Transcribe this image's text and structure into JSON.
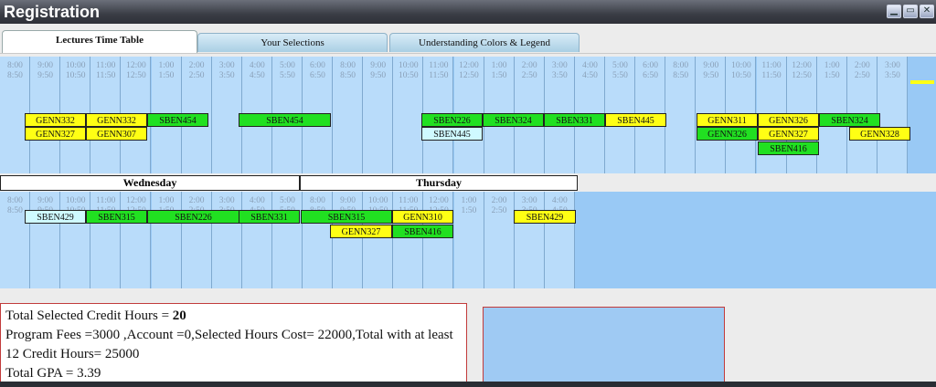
{
  "window": {
    "title": "Registration",
    "minimize": "▁",
    "maximize": "▭",
    "close": "✕"
  },
  "tabs": [
    "Lectures Time Table",
    "Your Selections",
    "Understanding Colors & Legend"
  ],
  "day_headers_row2": [
    "Wednesday",
    "Thursday"
  ],
  "time_labels_row1": [
    [
      "8:00",
      "8:50"
    ],
    [
      "9:00",
      "9:50"
    ],
    [
      "10:00",
      "10:50"
    ],
    [
      "11:00",
      "11:50"
    ],
    [
      "12:00",
      "12:50"
    ],
    [
      "1:00",
      "1:50"
    ],
    [
      "2:00",
      "2:50"
    ],
    [
      "3:00",
      "3:50"
    ],
    [
      "4:00",
      "4:50"
    ],
    [
      "5:00",
      "5:50"
    ],
    [
      "6:00",
      "6:50"
    ],
    [
      "8:00",
      "8:50"
    ],
    [
      "9:00",
      "9:50"
    ],
    [
      "10:00",
      "10:50"
    ],
    [
      "11:00",
      "11:50"
    ],
    [
      "12:00",
      "12:50"
    ],
    [
      "1:00",
      "1:50"
    ],
    [
      "2:00",
      "2:50"
    ],
    [
      "3:00",
      "3:50"
    ],
    [
      "4:00",
      "4:50"
    ],
    [
      "5:00",
      "5:50"
    ],
    [
      "6:00",
      "6:50"
    ],
    [
      "8:00",
      "8:50"
    ],
    [
      "9:00",
      "9:50"
    ],
    [
      "10:00",
      "10:50"
    ],
    [
      "11:00",
      "11:50"
    ],
    [
      "12:00",
      "12:50"
    ],
    [
      "1:00",
      "1:50"
    ],
    [
      "2:00",
      "2:50"
    ],
    [
      "3:00",
      "3:50"
    ]
  ],
  "time_labels_row2": [
    [
      "8:00",
      "8:50"
    ],
    [
      "9:00",
      "9:50"
    ],
    [
      "10:00",
      "10:50"
    ],
    [
      "11:00",
      "11:50"
    ],
    [
      "12:00",
      "12:50"
    ],
    [
      "1:00",
      "1:50"
    ],
    [
      "2:00",
      "2:50"
    ],
    [
      "3:00",
      "3:50"
    ],
    [
      "4:00",
      "4:50"
    ],
    [
      "5:00",
      "5:50"
    ],
    [
      "8:00",
      "8:50"
    ],
    [
      "9:00",
      "9:50"
    ],
    [
      "10:00",
      "10:50"
    ],
    [
      "11:00",
      "11:50"
    ],
    [
      "12:00",
      "12:50"
    ],
    [
      "1:00",
      "1:50"
    ],
    [
      "2:00",
      "2:50"
    ],
    [
      "3:00",
      "3:50"
    ],
    [
      "4:00",
      "4:50"
    ]
  ],
  "classes_row1": [
    {
      "code": "GENN332",
      "color": "yellow"
    },
    {
      "code": "GENN332",
      "color": "yellow"
    },
    {
      "code": "SBEN454",
      "color": "green"
    },
    {
      "code": "SBEN454",
      "color": "green"
    },
    {
      "code": "GENN327",
      "color": "yellow"
    },
    {
      "code": "GENN307",
      "color": "yellow"
    },
    {
      "code": "SBEN226",
      "color": "green"
    },
    {
      "code": "SBEN324",
      "color": "green"
    },
    {
      "code": "SBEN331",
      "color": "green"
    },
    {
      "code": "SBEN445",
      "color": "yellow"
    },
    {
      "code": "SBEN445",
      "color": "cyan"
    },
    {
      "code": "GENN311",
      "color": "yellow"
    },
    {
      "code": "GENN326",
      "color": "yellow"
    },
    {
      "code": "SBEN324",
      "color": "green"
    },
    {
      "code": "GENN326",
      "color": "green"
    },
    {
      "code": "GENN327",
      "color": "yellow"
    },
    {
      "code": "GENN328",
      "color": "yellow"
    },
    {
      "code": "SBEN416",
      "color": "green"
    }
  ],
  "classes_row2": [
    {
      "code": "SBEN429",
      "color": "cyan"
    },
    {
      "code": "SBEN315",
      "color": "green"
    },
    {
      "code": "SBEN226",
      "color": "green"
    },
    {
      "code": "SBEN331",
      "color": "green"
    },
    {
      "code": "SBEN315",
      "color": "green"
    },
    {
      "code": "GENN310",
      "color": "yellow"
    },
    {
      "code": "SBEN429",
      "color": "yellow"
    },
    {
      "code": "GENN327",
      "color": "yellow"
    },
    {
      "code": "SBEN416",
      "color": "green"
    }
  ],
  "summary": {
    "credit_label": "Total Selected Credit Hours = ",
    "credit_value": "20",
    "fees_line": "Program Fees =3000 ,Account =0,Selected Hours Cost= 22000,Total with at least 12 Credit Hours= 25000",
    "gpa_line": "Total GPA = 3.39"
  },
  "colors": {
    "green": "#21e021",
    "yellow": "#ffff14",
    "cyan": "#cffaff"
  }
}
